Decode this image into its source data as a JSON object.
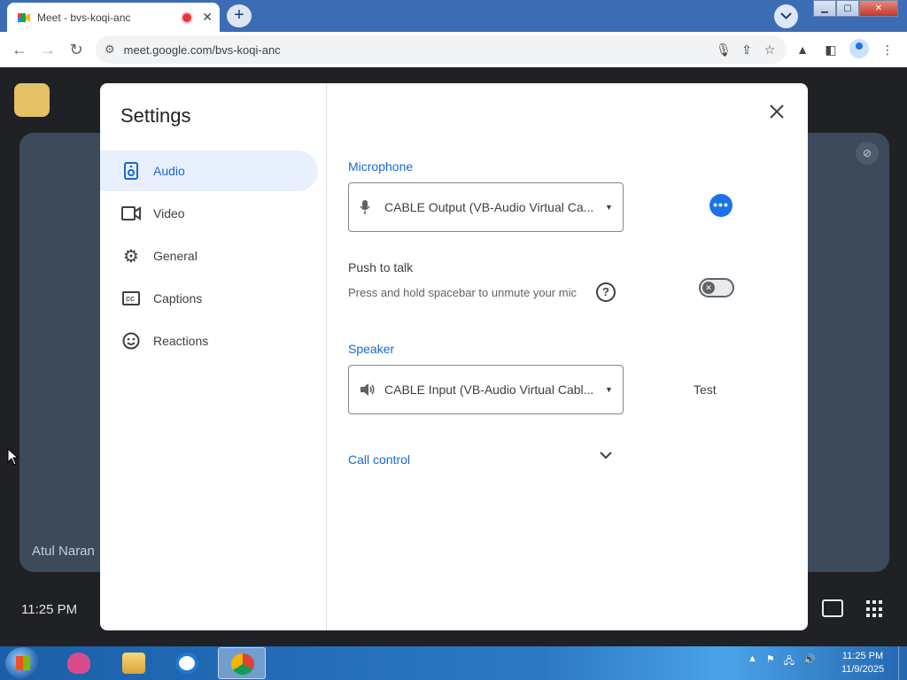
{
  "browser": {
    "tab_title": "Meet - bvs-koqi-anc",
    "new_tab_label": "+",
    "url": "meet.google.com/bvs-koqi-anc"
  },
  "meet": {
    "participant_name": "Atul Naran",
    "clock": "11:25 PM"
  },
  "settings": {
    "title": "Settings",
    "nav": [
      {
        "label": "Audio",
        "icon": "speaker-icon",
        "active": true
      },
      {
        "label": "Video",
        "icon": "video-camera-icon"
      },
      {
        "label": "General",
        "icon": "gear-icon"
      },
      {
        "label": "Captions",
        "icon": "captions-icon"
      },
      {
        "label": "Reactions",
        "icon": "emoji-icon"
      }
    ],
    "microphone": {
      "label": "Microphone",
      "value": "CABLE Output (VB-Audio Virtual Ca..."
    },
    "push_to_talk": {
      "title": "Push to talk",
      "description": "Press and hold spacebar to unmute your mic",
      "enabled": false
    },
    "speaker": {
      "label": "Speaker",
      "value": "CABLE Input (VB-Audio Virtual Cabl...",
      "test_label": "Test"
    },
    "call_control": {
      "label": "Call control"
    }
  },
  "taskbar": {
    "time": "11:25 PM",
    "date": "11/9/2025"
  },
  "colors": {
    "accent": "#1a73e8",
    "active_nav_bg": "#e8f0fe",
    "meet_bg": "#202124"
  }
}
